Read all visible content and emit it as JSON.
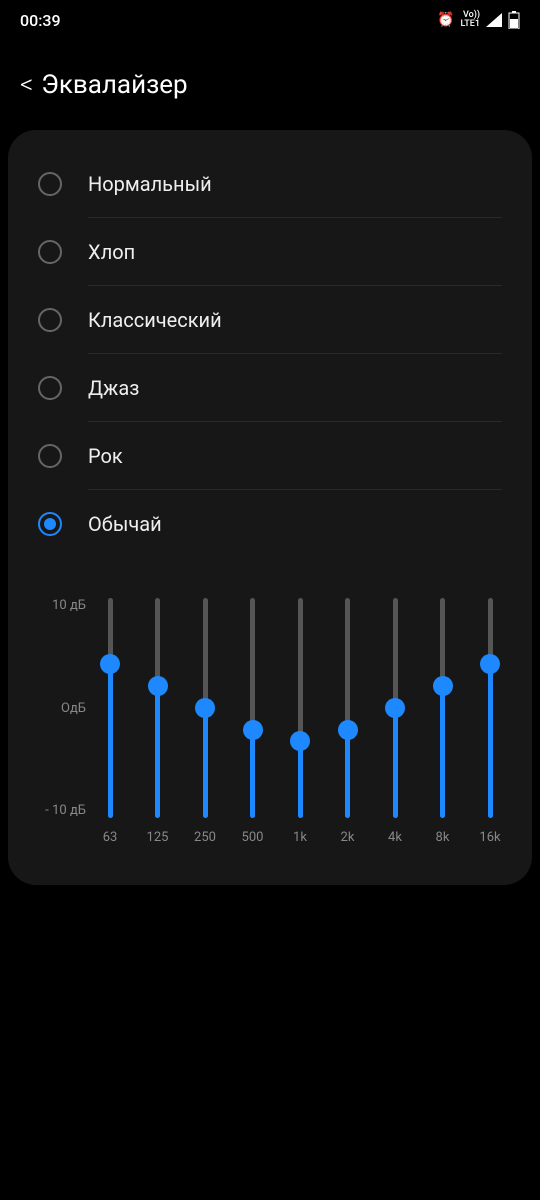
{
  "status": {
    "time": "00:39",
    "alarm": "⏰",
    "volte_top": "Vo))",
    "volte_bottom": "LTE1"
  },
  "header": {
    "back": "<",
    "title": "Эквалайзер"
  },
  "presets": [
    {
      "label": "Нормальный",
      "selected": false
    },
    {
      "label": "Хлоп",
      "selected": false
    },
    {
      "label": "Классический",
      "selected": false
    },
    {
      "label": "Джаз",
      "selected": false
    },
    {
      "label": "Рок",
      "selected": false
    },
    {
      "label": "Обычай",
      "selected": true
    }
  ],
  "chart_data": {
    "type": "bar",
    "categories": [
      "63",
      "125",
      "250",
      "500",
      "1k",
      "2k",
      "4k",
      "8k",
      "16k"
    ],
    "values": [
      4,
      2,
      0,
      -2,
      -3,
      -2,
      0,
      2,
      4
    ],
    "ylabel": "дБ",
    "ylim": [
      -10,
      10
    ],
    "yticks": [
      "10 дБ",
      "ОдБ",
      "- 10 дБ"
    ]
  }
}
